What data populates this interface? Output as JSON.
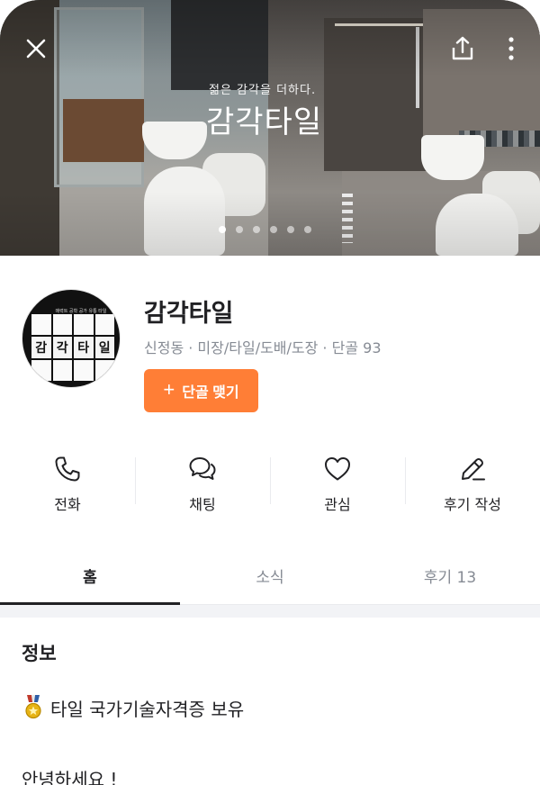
{
  "hero": {
    "subtitle": "젊은 감각을 더하다.",
    "title": "감각타일",
    "slide_count": 6,
    "active_slide": 1
  },
  "icons": {
    "close": "close-icon",
    "share": "share-icon",
    "more": "more-vertical-icon",
    "phone": "phone-icon",
    "chat": "chat-bubbles-icon",
    "heart": "heart-icon",
    "pencil": "pencil-icon",
    "medal": "medal-icon"
  },
  "avatar": {
    "caption": "매력트 공학 공가 유통 타일",
    "letters": [
      "",
      "",
      "",
      "",
      "감",
      "각",
      "타",
      "일",
      "",
      "",
      "",
      ""
    ]
  },
  "profile": {
    "name": "감각타일",
    "meta": "신정동 · 미장/타일/도배/도장 · 단골 93",
    "regular_button": "단골 맺기"
  },
  "actions": [
    {
      "label": "전화"
    },
    {
      "label": "채팅"
    },
    {
      "label": "관심"
    },
    {
      "label": "후기 작성"
    }
  ],
  "tabs": [
    {
      "label": "홈",
      "active": true
    },
    {
      "label": "소식",
      "active": false
    },
    {
      "label": "후기 13",
      "active": false
    }
  ],
  "info": {
    "title": "정보",
    "certificate": "타일 국가기술자격증 보유",
    "greeting": "안녕하세요 !"
  },
  "colors": {
    "accent": "#ff7e36",
    "text": "#212124",
    "muted": "#868b94"
  }
}
